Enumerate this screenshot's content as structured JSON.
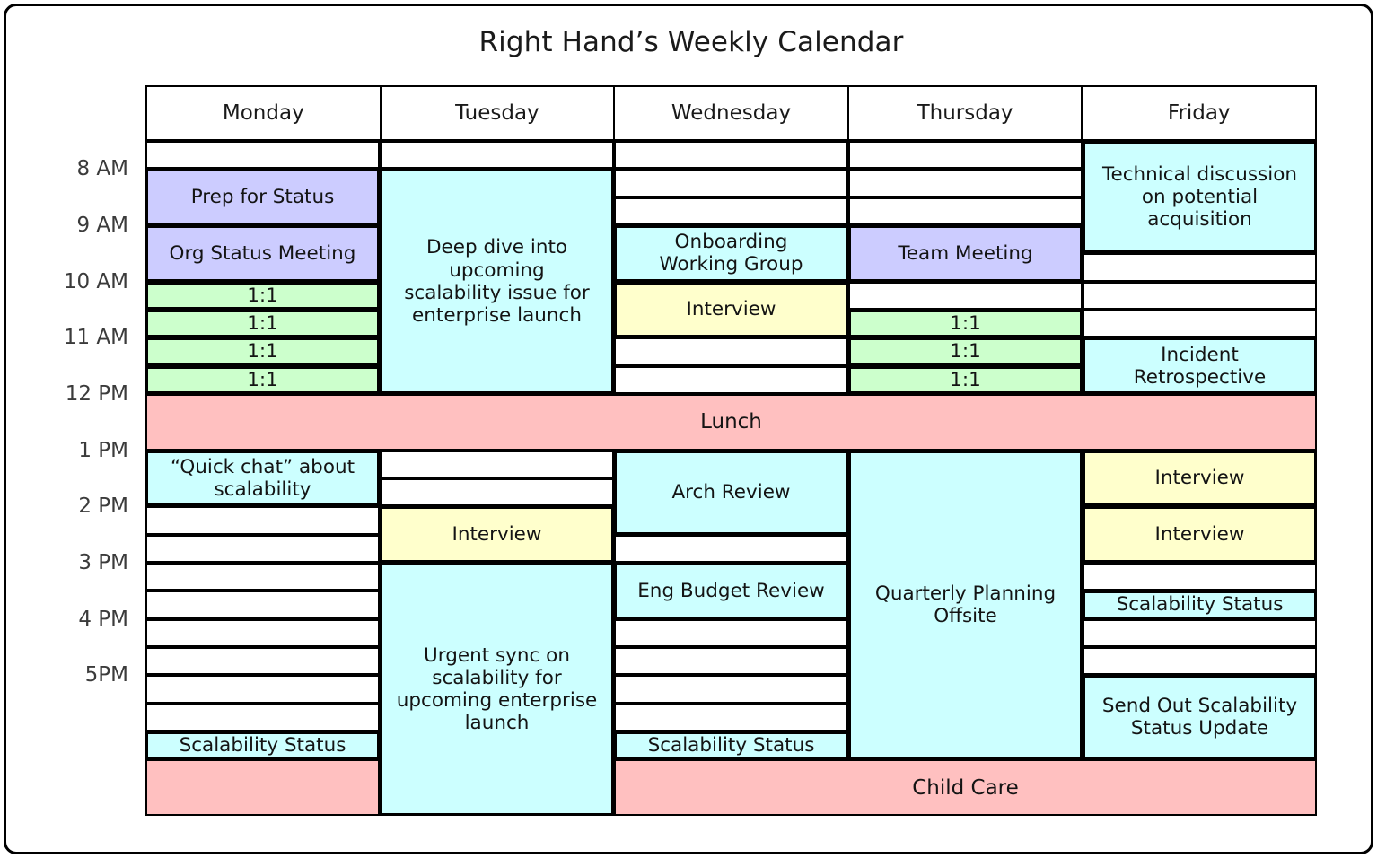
{
  "title": "Right Hand’s Weekly Calendar",
  "colors": {
    "blue": "#ccffff",
    "purple": "#ccccff",
    "green": "#ccffcc",
    "yellow": "#ffffcc",
    "pink": "#ffc0c0",
    "empty": "#ffffff",
    "border": "#000000"
  },
  "day_headers": [
    "Monday",
    "Tuesday",
    "Wednesday",
    "Thursday",
    "Friday"
  ],
  "time_labels": [
    {
      "label": "8 AM",
      "slot": 1
    },
    {
      "label": "9 AM",
      "slot": 3
    },
    {
      "label": "10 AM",
      "slot": 5
    },
    {
      "label": "11 AM",
      "slot": 7
    },
    {
      "label": "12 PM",
      "slot": 9
    },
    {
      "label": "1 PM",
      "slot": 11
    },
    {
      "label": "2 PM",
      "slot": 13
    },
    {
      "label": "3 PM",
      "slot": 15
    },
    {
      "label": "4 PM",
      "slot": 17
    },
    {
      "label": "5PM",
      "slot": 19
    }
  ],
  "slots_total": 24,
  "bands": [
    {
      "name": "lunch",
      "label": "Lunch",
      "color": "pink",
      "start": 9,
      "span": 2,
      "col_start": 0,
      "col_span": 5
    },
    {
      "name": "child-care",
      "label": "Child Care",
      "color": "pink",
      "start": 22,
      "span": 2,
      "col_start": 2,
      "col_span": 3
    }
  ],
  "columns": [
    {
      "day": "Monday",
      "events": [
        {
          "label": "",
          "color": "empty",
          "start": 0,
          "span": 1
        },
        {
          "label": "Prep for Status",
          "color": "purple",
          "start": 1,
          "span": 2
        },
        {
          "label": "Org Status Meeting",
          "color": "purple",
          "start": 3,
          "span": 2
        },
        {
          "label": "1:1",
          "color": "green",
          "start": 5,
          "span": 1
        },
        {
          "label": "1:1",
          "color": "green",
          "start": 6,
          "span": 1
        },
        {
          "label": "1:1",
          "color": "green",
          "start": 7,
          "span": 1
        },
        {
          "label": "1:1",
          "color": "green",
          "start": 8,
          "span": 1
        },
        {
          "label": "“Quick chat” about\nscalability",
          "color": "blue",
          "start": 11,
          "span": 2
        },
        {
          "label": "",
          "color": "empty",
          "start": 13,
          "span": 1
        },
        {
          "label": "",
          "color": "empty",
          "start": 14,
          "span": 1
        },
        {
          "label": "",
          "color": "empty",
          "start": 15,
          "span": 1
        },
        {
          "label": "",
          "color": "empty",
          "start": 16,
          "span": 1
        },
        {
          "label": "",
          "color": "empty",
          "start": 17,
          "span": 1
        },
        {
          "label": "",
          "color": "empty",
          "start": 18,
          "span": 1
        },
        {
          "label": "",
          "color": "empty",
          "start": 19,
          "span": 1
        },
        {
          "label": "",
          "color": "empty",
          "start": 20,
          "span": 1
        },
        {
          "label": "Scalability Status",
          "color": "blue",
          "start": 21,
          "span": 1
        },
        {
          "label": "",
          "color": "pink",
          "start": 22,
          "span": 2
        }
      ]
    },
    {
      "day": "Tuesday",
      "events": [
        {
          "label": "",
          "color": "empty",
          "start": 0,
          "span": 1
        },
        {
          "label": "Deep dive into\nupcoming\nscalability issue for\nenterprise launch",
          "color": "blue",
          "start": 1,
          "span": 8
        },
        {
          "label": "",
          "color": "empty",
          "start": 11,
          "span": 1
        },
        {
          "label": "",
          "color": "empty",
          "start": 12,
          "span": 1
        },
        {
          "label": "Interview",
          "color": "yellow",
          "start": 13,
          "span": 2
        },
        {
          "label": "Urgent sync on\nscalability for\nupcoming enterprise\nlaunch",
          "color": "blue",
          "start": 15,
          "span": 9
        }
      ]
    },
    {
      "day": "Wednesday",
      "events": [
        {
          "label": "",
          "color": "empty",
          "start": 0,
          "span": 1
        },
        {
          "label": "",
          "color": "empty",
          "start": 1,
          "span": 1
        },
        {
          "label": "",
          "color": "empty",
          "start": 2,
          "span": 1
        },
        {
          "label": "Onboarding\nWorking Group",
          "color": "blue",
          "start": 3,
          "span": 2
        },
        {
          "label": "Interview",
          "color": "yellow",
          "start": 5,
          "span": 2
        },
        {
          "label": "",
          "color": "empty",
          "start": 7,
          "span": 1
        },
        {
          "label": "",
          "color": "empty",
          "start": 8,
          "span": 1
        },
        {
          "label": "Arch Review",
          "color": "blue",
          "start": 11,
          "span": 3
        },
        {
          "label": "",
          "color": "empty",
          "start": 14,
          "span": 1
        },
        {
          "label": "Eng Budget Review",
          "color": "blue",
          "start": 15,
          "span": 2
        },
        {
          "label": "",
          "color": "empty",
          "start": 17,
          "span": 1
        },
        {
          "label": "",
          "color": "empty",
          "start": 18,
          "span": 1
        },
        {
          "label": "",
          "color": "empty",
          "start": 19,
          "span": 1
        },
        {
          "label": "",
          "color": "empty",
          "start": 20,
          "span": 1
        },
        {
          "label": "Scalability Status",
          "color": "blue",
          "start": 21,
          "span": 1
        }
      ]
    },
    {
      "day": "Thursday",
      "events": [
        {
          "label": "",
          "color": "empty",
          "start": 0,
          "span": 1
        },
        {
          "label": "",
          "color": "empty",
          "start": 1,
          "span": 1
        },
        {
          "label": "",
          "color": "empty",
          "start": 2,
          "span": 1
        },
        {
          "label": "Team Meeting",
          "color": "purple",
          "start": 3,
          "span": 2
        },
        {
          "label": "",
          "color": "empty",
          "start": 5,
          "span": 1
        },
        {
          "label": "1:1",
          "color": "green",
          "start": 6,
          "span": 1
        },
        {
          "label": "1:1",
          "color": "green",
          "start": 7,
          "span": 1
        },
        {
          "label": "1:1",
          "color": "green",
          "start": 8,
          "span": 1
        },
        {
          "label": "Quarterly Planning\nOffsite",
          "color": "blue",
          "start": 11,
          "span": 11
        }
      ]
    },
    {
      "day": "Friday",
      "events": [
        {
          "label": "Technical discussion\non potential\nacquisition",
          "color": "blue",
          "start": 0,
          "span": 4
        },
        {
          "label": "",
          "color": "empty",
          "start": 4,
          "span": 1
        },
        {
          "label": "",
          "color": "empty",
          "start": 5,
          "span": 1
        },
        {
          "label": "",
          "color": "empty",
          "start": 6,
          "span": 1
        },
        {
          "label": "Incident\nRetrospective",
          "color": "blue",
          "start": 7,
          "span": 2
        },
        {
          "label": "Interview",
          "color": "yellow",
          "start": 11,
          "span": 2
        },
        {
          "label": "Interview",
          "color": "yellow",
          "start": 13,
          "span": 2
        },
        {
          "label": "",
          "color": "empty",
          "start": 15,
          "span": 1
        },
        {
          "label": "Scalability Status",
          "color": "blue",
          "start": 16,
          "span": 1
        },
        {
          "label": "",
          "color": "empty",
          "start": 17,
          "span": 1
        },
        {
          "label": "",
          "color": "empty",
          "start": 18,
          "span": 1
        },
        {
          "label": "Send Out Scalability\nStatus Update",
          "color": "blue",
          "start": 19,
          "span": 3
        }
      ]
    }
  ]
}
